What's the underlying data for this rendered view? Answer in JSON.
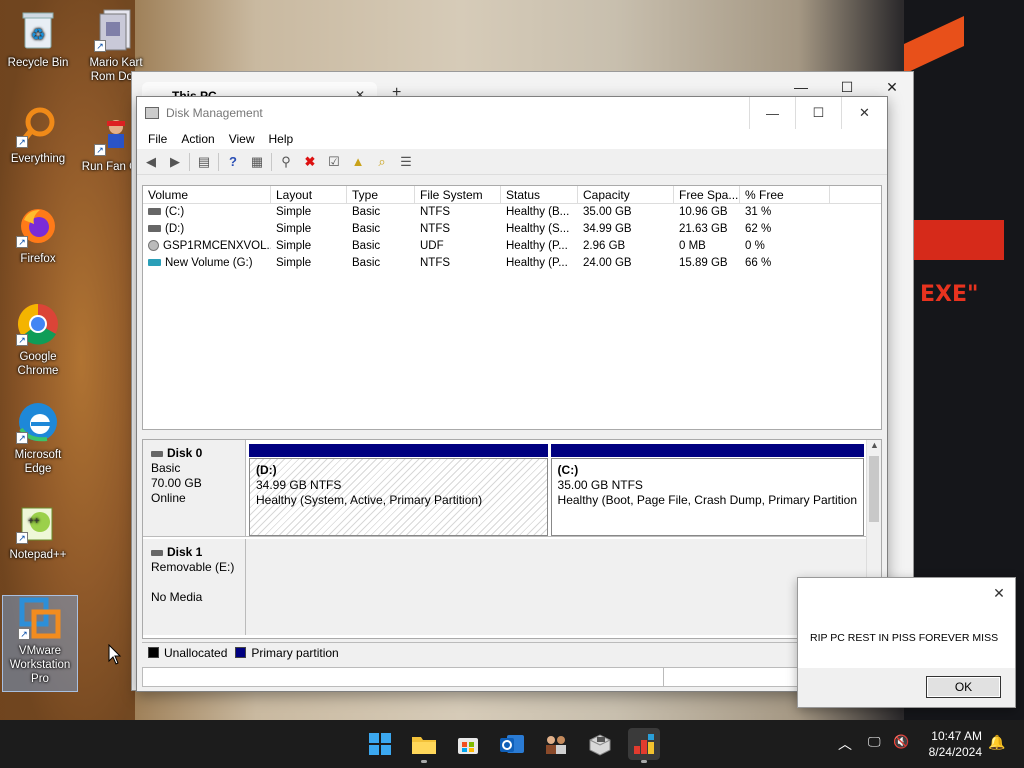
{
  "desktop": {
    "icons": [
      {
        "label": "Recycle Bin",
        "icon": "recycle-bin-icon"
      },
      {
        "label": "Mario Kart Rom Dow",
        "icon": "mario-kart-icon"
      },
      {
        "label": "Everything",
        "icon": "everything-search-icon"
      },
      {
        "label": "Run Fan Guy",
        "icon": "run-fan-guy-icon"
      },
      {
        "label": "Firefox",
        "icon": "firefox-icon"
      },
      {
        "label": "Google Chrome",
        "icon": "chrome-icon"
      },
      {
        "label": "Microsoft Edge",
        "icon": "edge-icon"
      },
      {
        "label": "Notepad++",
        "icon": "notepadpp-icon"
      },
      {
        "label": "VMware Workstation Pro",
        "icon": "vmware-icon"
      }
    ],
    "wallpaper_text": "EXE\""
  },
  "this_pc_window": {
    "tab_title": "This PC",
    "tab_close": "✕",
    "new_tab": "+",
    "minimize": "—",
    "maximize": "☐",
    "close": "✕"
  },
  "disk_mgmt": {
    "title": "Disk Management",
    "controls": {
      "minimize": "—",
      "maximize": "☐",
      "close": "✕"
    },
    "menu": [
      "File",
      "Action",
      "View",
      "Help"
    ],
    "columns": [
      "Volume",
      "Layout",
      "Type",
      "File System",
      "Status",
      "Capacity",
      "Free Spa...",
      "% Free"
    ],
    "volumes": [
      {
        "volume": "(C:)",
        "layout": "Simple",
        "type": "Basic",
        "fs": "NTFS",
        "status": "Healthy (B...",
        "capacity": "35.00 GB",
        "free": "10.96 GB",
        "pct": "31 %",
        "icon": "disk"
      },
      {
        "volume": "(D:)",
        "layout": "Simple",
        "type": "Basic",
        "fs": "NTFS",
        "status": "Healthy (S...",
        "capacity": "34.99 GB",
        "free": "21.63 GB",
        "pct": "62 %",
        "icon": "disk"
      },
      {
        "volume": "GSP1RMCENXVOL...",
        "layout": "Simple",
        "type": "Basic",
        "fs": "UDF",
        "status": "Healthy (P...",
        "capacity": "2.96 GB",
        "free": "0 MB",
        "pct": "0 %",
        "icon": "cd"
      },
      {
        "volume": "New Volume (G:)",
        "layout": "Simple",
        "type": "Basic",
        "fs": "NTFS",
        "status": "Healthy (P...",
        "capacity": "24.00 GB",
        "free": "15.89 GB",
        "pct": "66 %",
        "icon": "usb"
      }
    ],
    "disks": [
      {
        "name": "Disk 0",
        "type": "Basic",
        "size": "70.00 GB",
        "state": "Online",
        "partitions": [
          {
            "name": "(D:)",
            "size_fs": "34.99 GB NTFS",
            "status": "Healthy (System, Active, Primary Partition)",
            "selected": true
          },
          {
            "name": "(C:)",
            "size_fs": "35.00 GB NTFS",
            "status": "Healthy (Boot, Page File, Crash Dump, Primary Partition",
            "selected": false
          }
        ]
      },
      {
        "name": "Disk 1",
        "type": "Removable (E:)",
        "state": "No Media"
      }
    ],
    "legend": [
      {
        "label": "Unallocated",
        "color": "#000000"
      },
      {
        "label": "Primary partition",
        "color": "#000080"
      }
    ]
  },
  "message_box": {
    "text": "RIP PC REST IN PISS FOREVER MISS",
    "ok_label": "OK",
    "close": "✕"
  },
  "taskbar": {
    "time": "10:47 AM",
    "date": "8/24/2024",
    "apps": [
      "start-icon",
      "file-explorer-icon",
      "microsoft-store-icon",
      "outlook-icon",
      "people-app-icon",
      "package-app-icon",
      "task-manager-app-icon"
    ]
  }
}
